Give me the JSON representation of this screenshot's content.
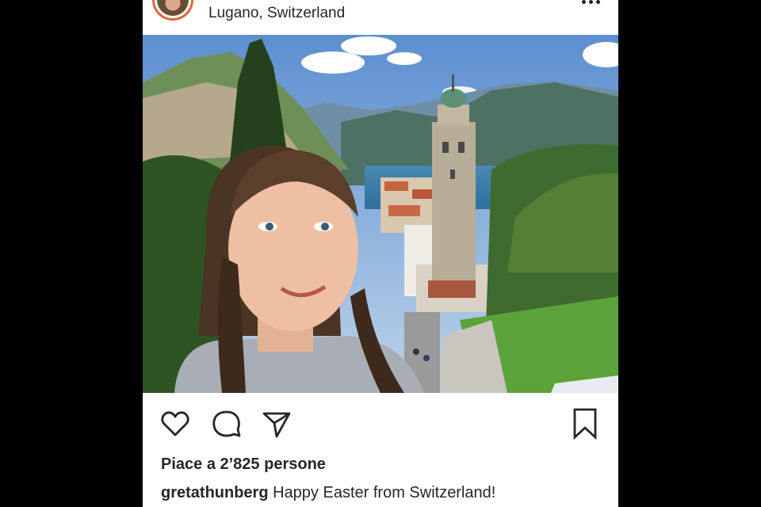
{
  "post": {
    "location": "Lugano, Switzerland",
    "likes_text": "Piace a 2’825 persone",
    "caption_user": "gretathunberg",
    "caption_text": " Happy Easter from Switzerland!"
  },
  "icons": {
    "like": "heart-icon",
    "comment": "comment-icon",
    "share": "paper-plane-icon",
    "save": "bookmark-icon",
    "more": "more-options-icon"
  },
  "colors": {
    "background": "#000000",
    "card": "#ffffff",
    "text": "#262626",
    "avatar_ring": "#e2633b"
  }
}
